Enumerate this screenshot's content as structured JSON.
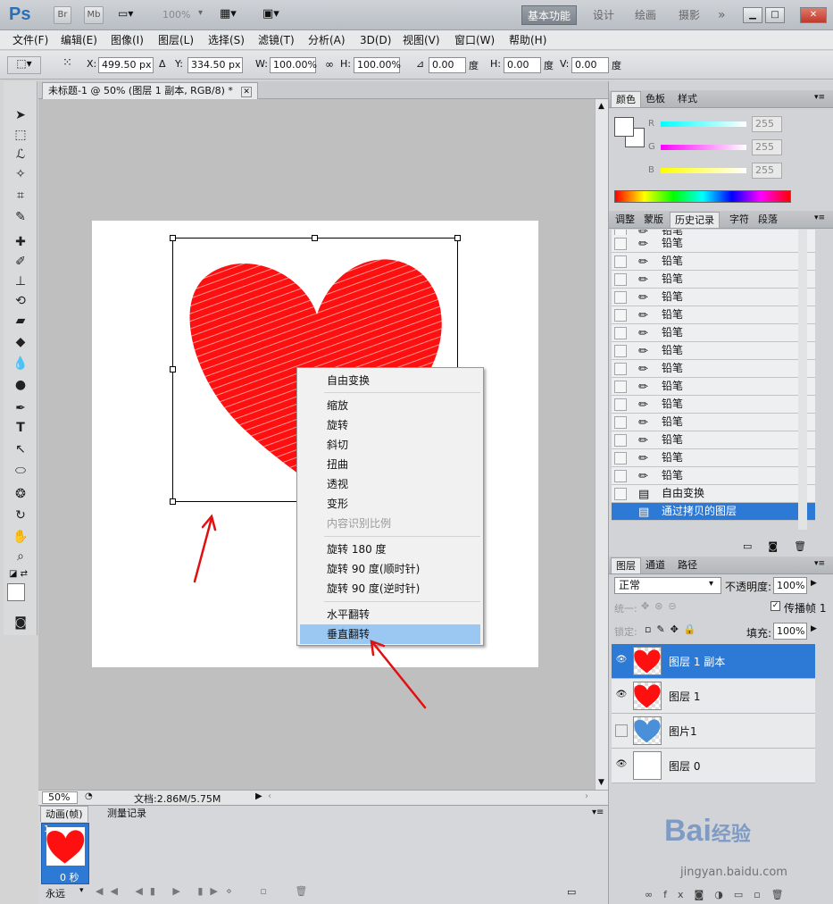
{
  "titlebar": {
    "logo": "Ps",
    "br": "Br",
    "mb": "Mb",
    "zoom": "100%",
    "workspaces": [
      "基本功能",
      "设计",
      "绘画",
      "摄影"
    ],
    "more": "»"
  },
  "menu": [
    "文件(F)",
    "编辑(E)",
    "图像(I)",
    "图层(L)",
    "选择(S)",
    "滤镜(T)",
    "分析(A)",
    "3D(D)",
    "视图(V)",
    "窗口(W)",
    "帮助(H)"
  ],
  "options": {
    "x_label": "X:",
    "x_value": "499.50 px",
    "y_label": "Y:",
    "y_value": "334.50 px",
    "w_label": "W:",
    "w_value": "100.00%",
    "h_label": "H:",
    "h_value": "100.00%",
    "angle_value": "0.00",
    "deg": "度",
    "hs_label": "H:",
    "hs_value": "0.00",
    "vs_label": "V:",
    "vs_value": "0.00"
  },
  "document": {
    "tab_title": "未标题-1 @ 50% (图层 1 副本, RGB/8) *",
    "zoom": "50%",
    "doc_info": "文档:2.86M/5.75M"
  },
  "context_menu": {
    "items": [
      {
        "label": "自由变换",
        "state": "normal"
      },
      {
        "label": "缩放",
        "state": "normal"
      },
      {
        "label": "旋转",
        "state": "normal"
      },
      {
        "label": "斜切",
        "state": "normal"
      },
      {
        "label": "扭曲",
        "state": "normal"
      },
      {
        "label": "透视",
        "state": "normal"
      },
      {
        "label": "变形",
        "state": "normal"
      },
      {
        "label": "内容识别比例",
        "state": "disabled"
      },
      {
        "label": "旋转 180 度",
        "state": "normal"
      },
      {
        "label": "旋转 90 度(顺时针)",
        "state": "normal"
      },
      {
        "label": "旋转 90 度(逆时针)",
        "state": "normal"
      },
      {
        "label": "水平翻转",
        "state": "normal"
      },
      {
        "label": "垂直翻转",
        "state": "highlighted"
      }
    ]
  },
  "animation_panel": {
    "tabs": [
      "动画(帧)",
      "测量记录"
    ],
    "frame_number": "1",
    "frame_time": "0 秒",
    "loop": "永远"
  },
  "color_panel": {
    "tabs": [
      "颜色",
      "色板",
      "样式"
    ],
    "channels": [
      {
        "label": "R",
        "value": "255",
        "color": "#00e5e5"
      },
      {
        "label": "G",
        "value": "255",
        "color": "#e500e5"
      },
      {
        "label": "B",
        "value": "255",
        "color": "#e5e500"
      }
    ]
  },
  "history_panel": {
    "tabs": [
      "调整",
      "蒙版",
      "历史记录",
      "字符",
      "段落"
    ],
    "items": [
      {
        "label": "铅笔",
        "icon": "pencil-icon"
      },
      {
        "label": "铅笔",
        "icon": "pencil-icon"
      },
      {
        "label": "铅笔",
        "icon": "pencil-icon"
      },
      {
        "label": "铅笔",
        "icon": "pencil-icon"
      },
      {
        "label": "铅笔",
        "icon": "pencil-icon"
      },
      {
        "label": "铅笔",
        "icon": "pencil-icon"
      },
      {
        "label": "铅笔",
        "icon": "pencil-icon"
      },
      {
        "label": "铅笔",
        "icon": "pencil-icon"
      },
      {
        "label": "铅笔",
        "icon": "pencil-icon"
      },
      {
        "label": "铅笔",
        "icon": "pencil-icon"
      },
      {
        "label": "铅笔",
        "icon": "pencil-icon"
      },
      {
        "label": "铅笔",
        "icon": "pencil-icon"
      },
      {
        "label": "铅笔",
        "icon": "pencil-icon"
      },
      {
        "label": "铅笔",
        "icon": "pencil-icon"
      },
      {
        "label": "铅笔",
        "icon": "pencil-icon"
      },
      {
        "label": "自由变换",
        "icon": "document-icon"
      },
      {
        "label": "通过拷贝的图层",
        "icon": "document-icon",
        "selected": true
      }
    ]
  },
  "layers_panel": {
    "tabs": [
      "图层",
      "通道",
      "路径"
    ],
    "blend_mode": "正常",
    "opacity_label": "不透明度:",
    "opacity_value": "100%",
    "unify_label": "统一:",
    "propagate_label": "传播帧 1",
    "lock_label": "锁定:",
    "fill_label": "填充:",
    "fill_value": "100%",
    "layers": [
      {
        "name": "图层 1 副本",
        "visible": true,
        "selected": true,
        "thumb": "red-heart"
      },
      {
        "name": "图层 1",
        "visible": true,
        "selected": false,
        "thumb": "red-heart"
      },
      {
        "name": "图片1",
        "visible": false,
        "selected": false,
        "thumb": "blue-heart"
      },
      {
        "name": "图层 0",
        "visible": true,
        "selected": false,
        "thumb": "white"
      }
    ]
  },
  "watermark": {
    "brand": "Bai",
    "brand2": "经验",
    "url": "jingyan.baidu.com"
  },
  "accent_colors": {
    "selection": "#2d7ad6",
    "menu_highlight": "#9bc8f3",
    "heart": "#ff1010",
    "arrow": "#e01010"
  }
}
